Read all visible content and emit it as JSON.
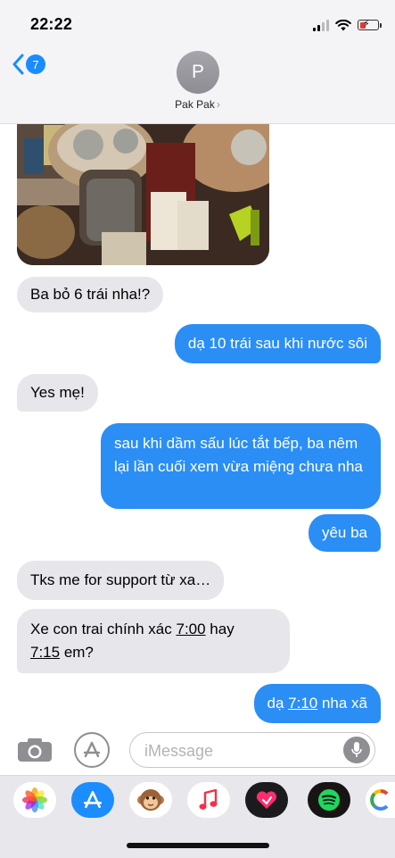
{
  "status_bar": {
    "time": "22:22"
  },
  "header": {
    "back_badge": "7",
    "avatar_initial": "P",
    "contact_name": "Pak Pak",
    "contact_chevron": "›"
  },
  "messages": [
    {
      "direction": "in",
      "text": "Ba bỏ 6 trái nha!?"
    },
    {
      "direction": "out",
      "text": "dạ 10 trái sau khi nước sôi"
    },
    {
      "direction": "in",
      "text": "Yes mẹ!"
    },
    {
      "direction": "out",
      "text": "sau khi dầm sấu lúc tắt bếp, ba nêm lại lần cuối xem vừa miệng chưa nha"
    },
    {
      "direction": "out",
      "text": "yêu ba"
    },
    {
      "direction": "in",
      "text": "Tks me for support từ xa…"
    },
    {
      "direction": "in",
      "text_parts": [
        "Xe con trai chính xác ",
        "7:00",
        " hay",
        "7:15",
        " em?"
      ]
    },
    {
      "direction": "out",
      "text_parts": [
        "dạ ",
        "7:10",
        " nha xã"
      ]
    }
  ],
  "input": {
    "placeholder": "iMessage"
  },
  "icons": {
    "back": "chevron-left-icon",
    "camera": "camera-icon",
    "apps": "app-store-icon",
    "mic": "microphone-icon",
    "drawer": [
      "photos-icon",
      "app-store-icon",
      "animoji-icon",
      "music-icon",
      "digital-touch-icon",
      "spotify-icon",
      "google-icon"
    ]
  },
  "colors": {
    "outgoing": "#2a8ef5",
    "incoming": "#e6e6eb",
    "accent": "#1a8cff"
  }
}
